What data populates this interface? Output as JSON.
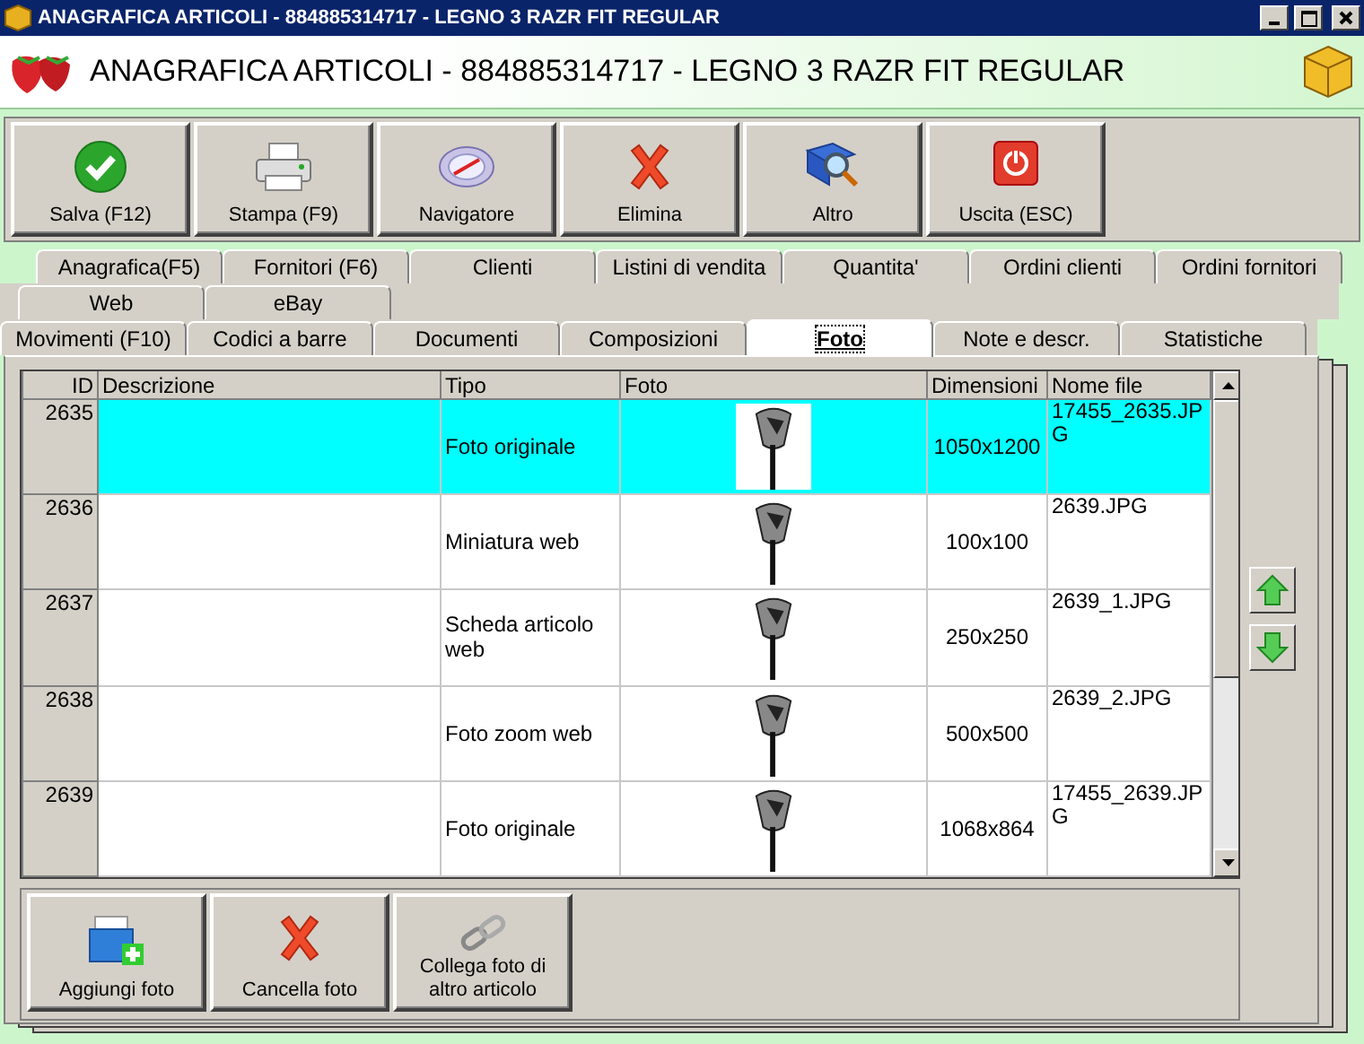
{
  "window": {
    "title": "ANAGRAFICA ARTICOLI - 884885314717 - LEGNO 3 RAZR FIT REGULAR"
  },
  "header": {
    "title": "ANAGRAFICA ARTICOLI - 884885314717 - LEGNO 3 RAZR FIT REGULAR"
  },
  "toolbar": [
    {
      "kind": "save",
      "label": "Salva (F12)"
    },
    {
      "kind": "print",
      "label": "Stampa (F9)"
    },
    {
      "kind": "navigator",
      "label": "Navigatore"
    },
    {
      "kind": "delete",
      "label": "Elimina"
    },
    {
      "kind": "more",
      "label": "Altro"
    },
    {
      "kind": "exit",
      "label": "Uscita (ESC)"
    }
  ],
  "tab_rows": [
    {
      "tabs": [
        {
          "label": "Anagrafica(F5)",
          "selected": false
        },
        {
          "label": "Fornitori (F6)",
          "selected": false
        },
        {
          "label": "Clienti",
          "selected": false
        },
        {
          "label": "Listini di vendita",
          "selected": false
        },
        {
          "label": "Quantita'",
          "selected": false
        },
        {
          "label": "Ordini clienti",
          "selected": false
        },
        {
          "label": "Ordini fornitori",
          "selected": false
        }
      ]
    },
    {
      "tabs": [
        {
          "label": "Web",
          "selected": false
        },
        {
          "label": "eBay",
          "selected": false
        }
      ]
    },
    {
      "tabs": [
        {
          "label": "Movimenti (F10)",
          "selected": false
        },
        {
          "label": "Codici a barre",
          "selected": false
        },
        {
          "label": "Documenti",
          "selected": false
        },
        {
          "label": "Composizioni",
          "selected": false
        },
        {
          "label": "Foto",
          "selected": true
        },
        {
          "label": "Note e descr.",
          "selected": false
        },
        {
          "label": "Statistiche",
          "selected": false
        }
      ]
    }
  ],
  "table": {
    "columns": [
      "ID",
      "Descrizione",
      "Tipo",
      "Foto",
      "Dimensioni",
      "Nome file"
    ],
    "rows": [
      {
        "id": "2635",
        "tipo": "Foto originale",
        "dimensioni": "1050x1200",
        "nome_file": "17455_2635.JPG",
        "selected": true
      },
      {
        "id": "2636",
        "tipo": "Miniatura web",
        "dimensioni": "100x100",
        "nome_file": "2639.JPG",
        "selected": false
      },
      {
        "id": "2637",
        "tipo": "Scheda articolo web",
        "dimensioni": "250x250",
        "nome_file": "2639_1.JPG",
        "selected": false
      },
      {
        "id": "2638",
        "tipo": "Foto zoom web",
        "dimensioni": "500x500",
        "nome_file": "2639_2.JPG",
        "selected": false
      },
      {
        "id": "2639",
        "tipo": "Foto originale",
        "dimensioni": "1068x864",
        "nome_file": "17455_2639.JPG",
        "selected": false
      }
    ]
  },
  "photo_buttons": [
    {
      "kind": "add",
      "label": "Aggiungi foto"
    },
    {
      "kind": "delete",
      "label": "Cancella foto"
    },
    {
      "kind": "link",
      "label": "Collega foto di altro articolo"
    }
  ]
}
